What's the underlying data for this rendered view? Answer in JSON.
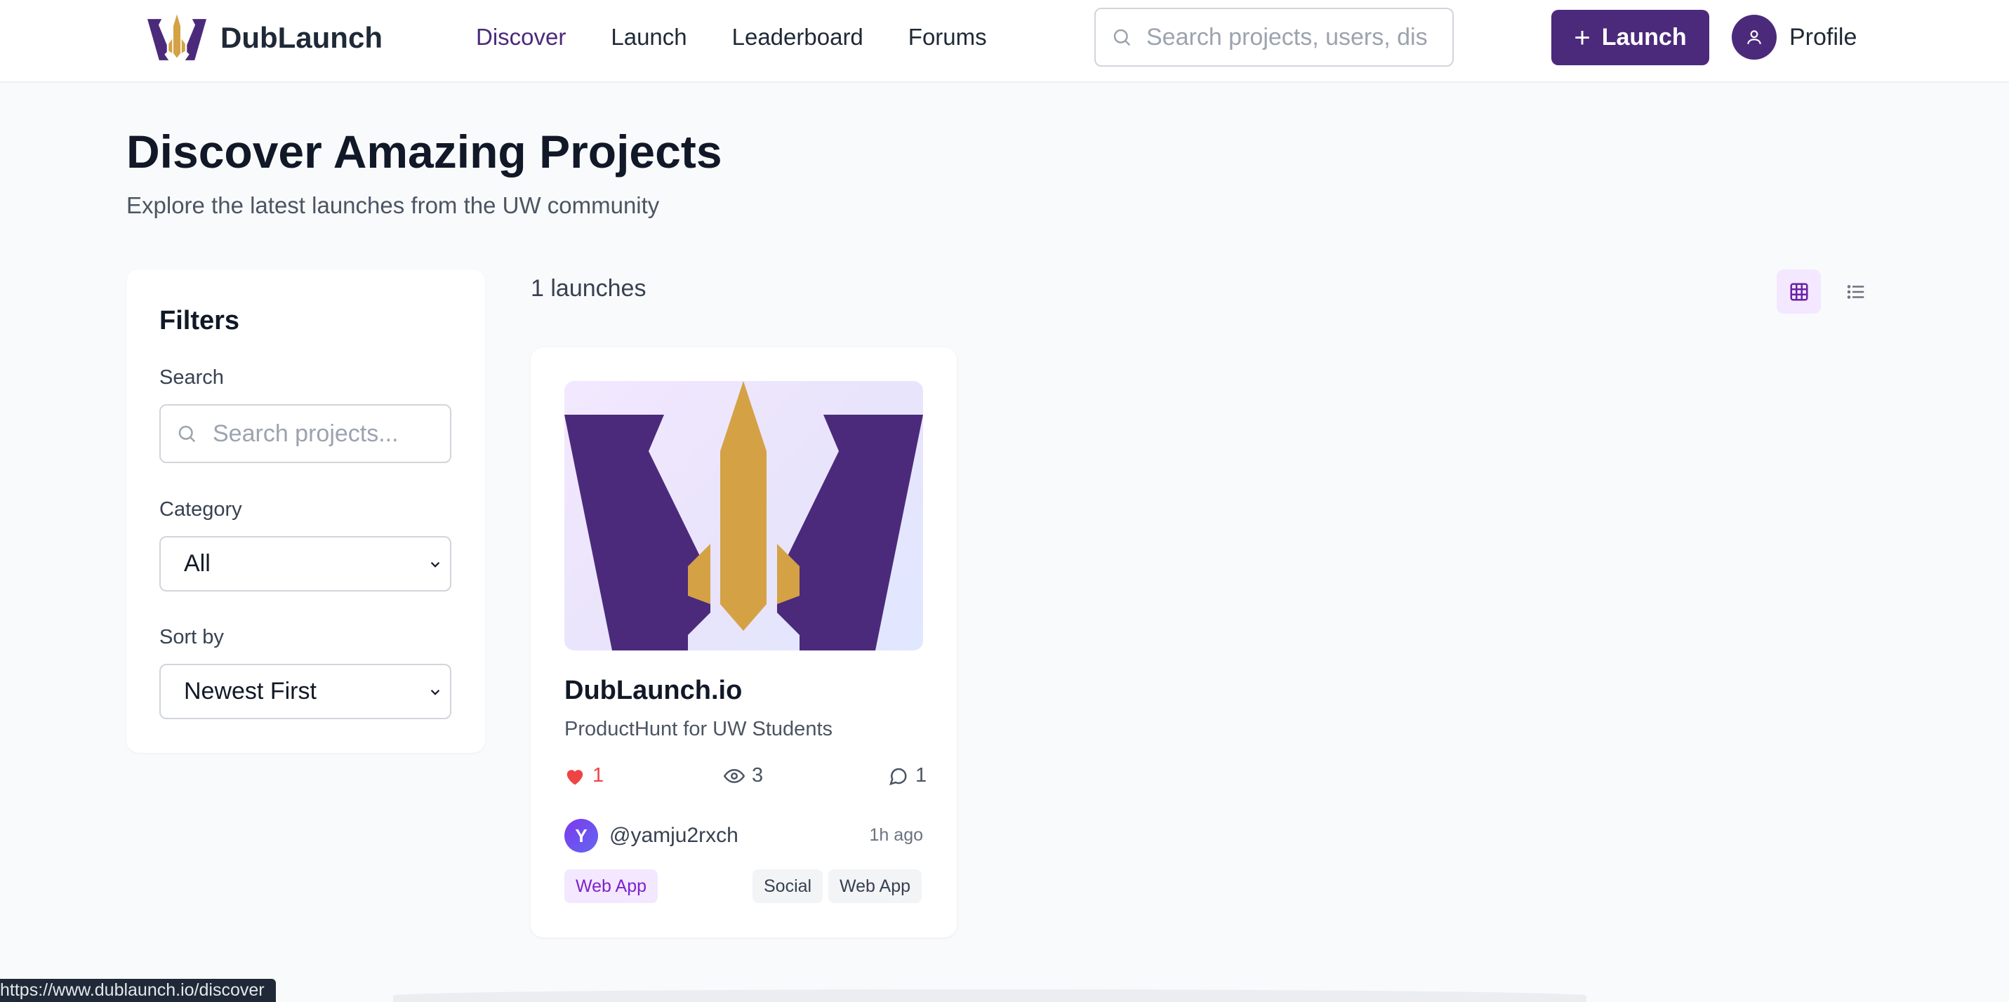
{
  "colors": {
    "brand": "#4b2a7b",
    "gold": "#d4a245",
    "like": "#ef4444",
    "tag_primary": "#7e22ce"
  },
  "nav": {
    "brand": "DubLaunch",
    "links": [
      "Discover",
      "Launch",
      "Leaderboard",
      "Forums"
    ],
    "active": "Discover",
    "search_placeholder": "Search projects, users, dis",
    "launch_button": "Launch",
    "launch_icon": "plus-icon",
    "profile_label": "Profile",
    "profile_icon": "user-icon"
  },
  "page": {
    "title": "Discover Amazing Projects",
    "subtitle": "Explore the latest launches from the UW community"
  },
  "filters": {
    "heading": "Filters",
    "search_label": "Search",
    "search_placeholder": "Search projects...",
    "category_label": "Category",
    "category_value": "All",
    "sort_label": "Sort by",
    "sort_value": "Newest First"
  },
  "results": {
    "count_text": "1 launches",
    "view_mode": "grid",
    "view_icons": [
      "grid-icon",
      "list-icon"
    ]
  },
  "projects": [
    {
      "title": "DubLaunch.io",
      "description": "ProductHunt for UW Students",
      "likes": "1",
      "views": "3",
      "comments": "1",
      "author_initial": "Y",
      "author": "@yamju2rxch",
      "time": "1h ago",
      "category_tag": "Web App",
      "tags": [
        "Social",
        "Web App"
      ]
    }
  ],
  "status_bar": {
    "url": "https://www.dublaunch.io/discover"
  }
}
